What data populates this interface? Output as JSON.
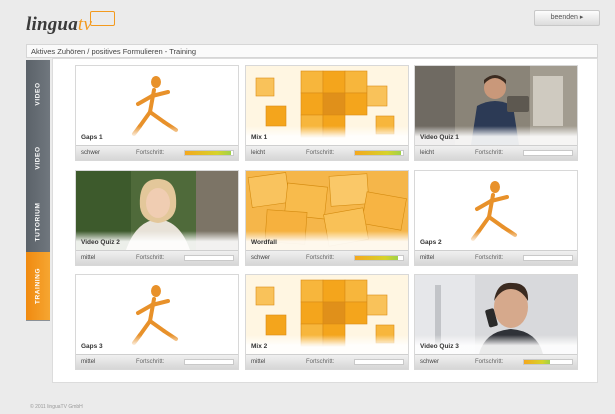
{
  "brand": {
    "name": "lingua",
    "suffix": "tv"
  },
  "header": {
    "close_label": "beenden ▸"
  },
  "breadcrumb": "Aktives Zuhören / positives Formulieren - Training",
  "sidebar": {
    "tabs": [
      {
        "label": "VIDEO"
      },
      {
        "label": "VIDEO"
      },
      {
        "label": "TUTORIUM"
      },
      {
        "label": "TRAINING"
      }
    ],
    "active_index": 3
  },
  "progress_label": "Fortschritt:",
  "tiles": [
    {
      "title": "Gaps 1",
      "difficulty": "schwer",
      "progress": 0.95,
      "thumb": "figure"
    },
    {
      "title": "Mix 1",
      "difficulty": "leicht",
      "progress": 0.95,
      "thumb": "cubes"
    },
    {
      "title": "Video Quiz 1",
      "difficulty": "leicht",
      "progress": 0,
      "thumb": "man"
    },
    {
      "title": "Video Quiz 2",
      "difficulty": "mittel",
      "progress": 0,
      "thumb": "woman"
    },
    {
      "title": "Wordfall",
      "difficulty": "schwer",
      "progress": 0.9,
      "thumb": "notes"
    },
    {
      "title": "Gaps 2",
      "difficulty": "mittel",
      "progress": 0,
      "thumb": "figure"
    },
    {
      "title": "Gaps 3",
      "difficulty": "mittel",
      "progress": 0,
      "thumb": "figure"
    },
    {
      "title": "Mix 2",
      "difficulty": "mittel",
      "progress": 0,
      "thumb": "cubes"
    },
    {
      "title": "Video Quiz 3",
      "difficulty": "schwer",
      "progress": 0.55,
      "thumb": "phone"
    }
  ],
  "footer": "© 2011 linguaTV GmbH",
  "colors": {
    "accent": "#f39a1e",
    "tab_bg": "#62696f"
  }
}
